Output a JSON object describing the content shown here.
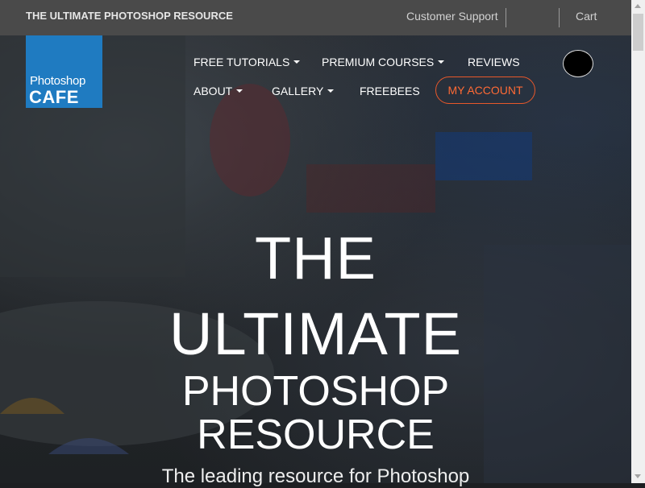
{
  "topbar": {
    "tagline": "THE ULTIMATE PHOTOSHOP RESOURCE",
    "support": "Customer Support",
    "cart": "Cart"
  },
  "logo": {
    "line1": "Photoshop",
    "line2": "CAFE"
  },
  "nav": {
    "free_tutorials": "FREE TUTORIALS",
    "premium_courses": "PREMIUM COURSES",
    "reviews": "REVIEWS",
    "about": "ABOUT",
    "gallery": "GALLERY",
    "freebees": "FREEBEES",
    "my_account": "MY ACCOUNT"
  },
  "hero": {
    "line1": "THE",
    "line2": "ULTIMATE",
    "line3": "PHOTOSHOP",
    "line4": "RESOURCE",
    "subtitle": "The leading resource for Photoshop"
  },
  "colors": {
    "logo_blue": "#1f7bc1",
    "account_orange": "#e8582a",
    "topbar_gray": "#4a4a4a"
  }
}
